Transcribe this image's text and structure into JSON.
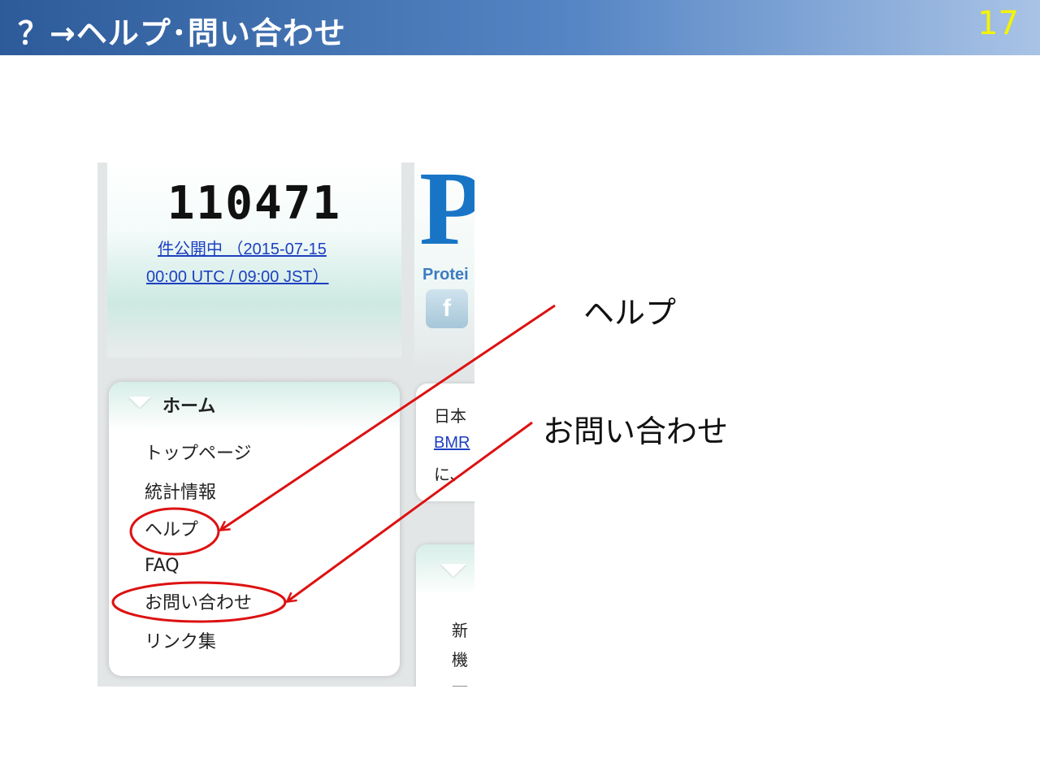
{
  "slide": {
    "title": "？→ヘルプ･問い合わせ",
    "page_number": "17"
  },
  "screenshot": {
    "counter": {
      "value": "110471",
      "line1": "件公開中 （2015-07-15",
      "line2": "00:00 UTC / 09:00 JST）"
    },
    "logo": {
      "letter": "P",
      "text": "Protei"
    },
    "facebook_label": "f",
    "menu": {
      "title": "ホーム",
      "items": [
        {
          "label": "トップページ"
        },
        {
          "label": "統計情報"
        },
        {
          "label": "ヘルプ"
        },
        {
          "label": "FAQ"
        },
        {
          "label": "お問い合わせ"
        },
        {
          "label": "リンク集"
        }
      ]
    },
    "info_box1": {
      "line1": "日本",
      "link": "BMR",
      "line3": "に、"
    },
    "info_box2": {
      "line1": "新",
      "line2": "機",
      "line3": "一"
    }
  },
  "callouts": {
    "help": "ヘルプ",
    "contact": "お問い合わせ"
  },
  "colors": {
    "header_start": "#2d5b9a",
    "header_end": "#a9c3e6",
    "page_number": "#f4f400",
    "annotation": "#dd1111",
    "link": "#1d3fc2"
  }
}
